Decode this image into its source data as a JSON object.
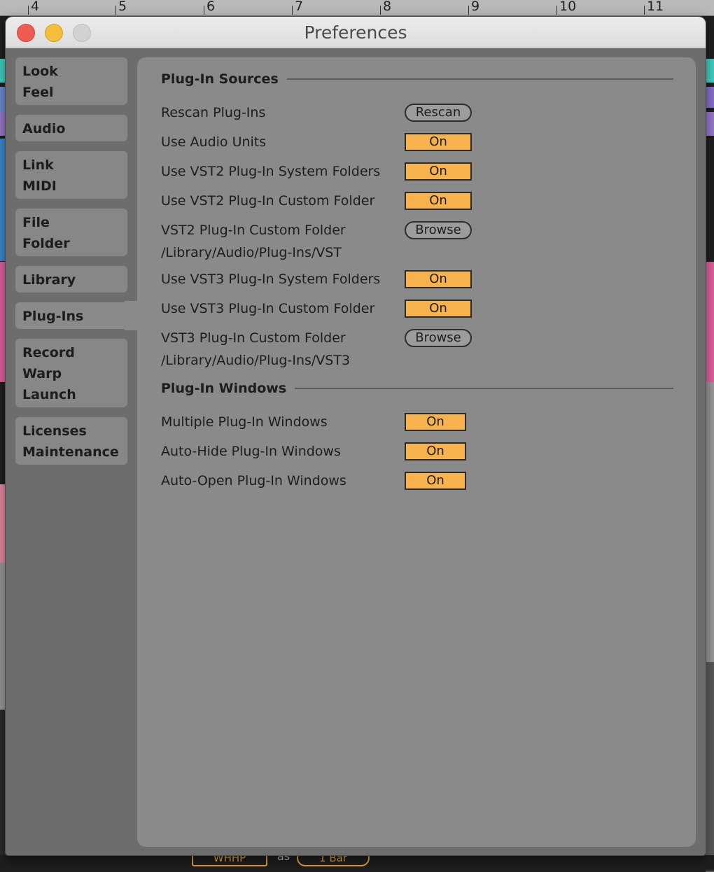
{
  "background": {
    "ruler_numbers": [
      "4",
      "5",
      "6",
      "7",
      "8",
      "9",
      "10",
      "11"
    ],
    "bottom": {
      "mode_label": "WHHP",
      "as_label": "as",
      "length_label": "1 Bar"
    },
    "colors": {
      "accent": "#e5a53b"
    }
  },
  "window": {
    "title": "Preferences",
    "controls": [
      "close",
      "minimize",
      "zoom"
    ],
    "colors": {
      "close": "#ee5b53",
      "minimize": "#f3bd3d",
      "zoom": "#d2d2d2"
    }
  },
  "sidebar": {
    "selected": "Plug-Ins",
    "items": [
      {
        "lines": [
          "Look",
          "Feel"
        ]
      },
      {
        "lines": [
          "Audio"
        ]
      },
      {
        "lines": [
          "Link",
          "MIDI"
        ]
      },
      {
        "lines": [
          "File",
          "Folder"
        ]
      },
      {
        "lines": [
          "Library"
        ]
      },
      {
        "lines": [
          "Plug-Ins"
        ]
      },
      {
        "lines": [
          "Record",
          "Warp",
          "Launch"
        ]
      },
      {
        "lines": [
          "Licenses",
          "Maintenance"
        ]
      }
    ]
  },
  "sections": {
    "sources": {
      "title": "Plug-In Sources",
      "rows": [
        {
          "label": "Rescan Plug-Ins",
          "control": "Rescan"
        },
        {
          "label": "Use Audio Units",
          "control": "On"
        },
        {
          "label": "Use VST2 Plug-In System Folders",
          "control": "On"
        },
        {
          "label": "Use VST2 Plug-In Custom Folder",
          "control": "On"
        },
        {
          "label": "VST2 Plug-In Custom Folder",
          "control": "Browse",
          "path": "/Library/Audio/Plug-Ins/VST"
        },
        {
          "label": "Use VST3 Plug-In System Folders",
          "control": "On"
        },
        {
          "label": "Use VST3 Plug-In Custom Folder",
          "control": "On"
        },
        {
          "label": "VST3 Plug-In Custom Folder",
          "control": "Browse",
          "path": "/Library/Audio/Plug-Ins/VST3"
        }
      ]
    },
    "windows": {
      "title": "Plug-In Windows",
      "rows": [
        {
          "label": "Multiple Plug-In Windows",
          "control": "On"
        },
        {
          "label": "Auto-Hide Plug-In Windows",
          "control": "On"
        },
        {
          "label": "Auto-Open Plug-In Windows",
          "control": "On"
        }
      ]
    }
  },
  "colors": {
    "toggle_on": "#f5b24d",
    "panel": "#8a8a8a",
    "window_bg": "#6d6d6d"
  }
}
